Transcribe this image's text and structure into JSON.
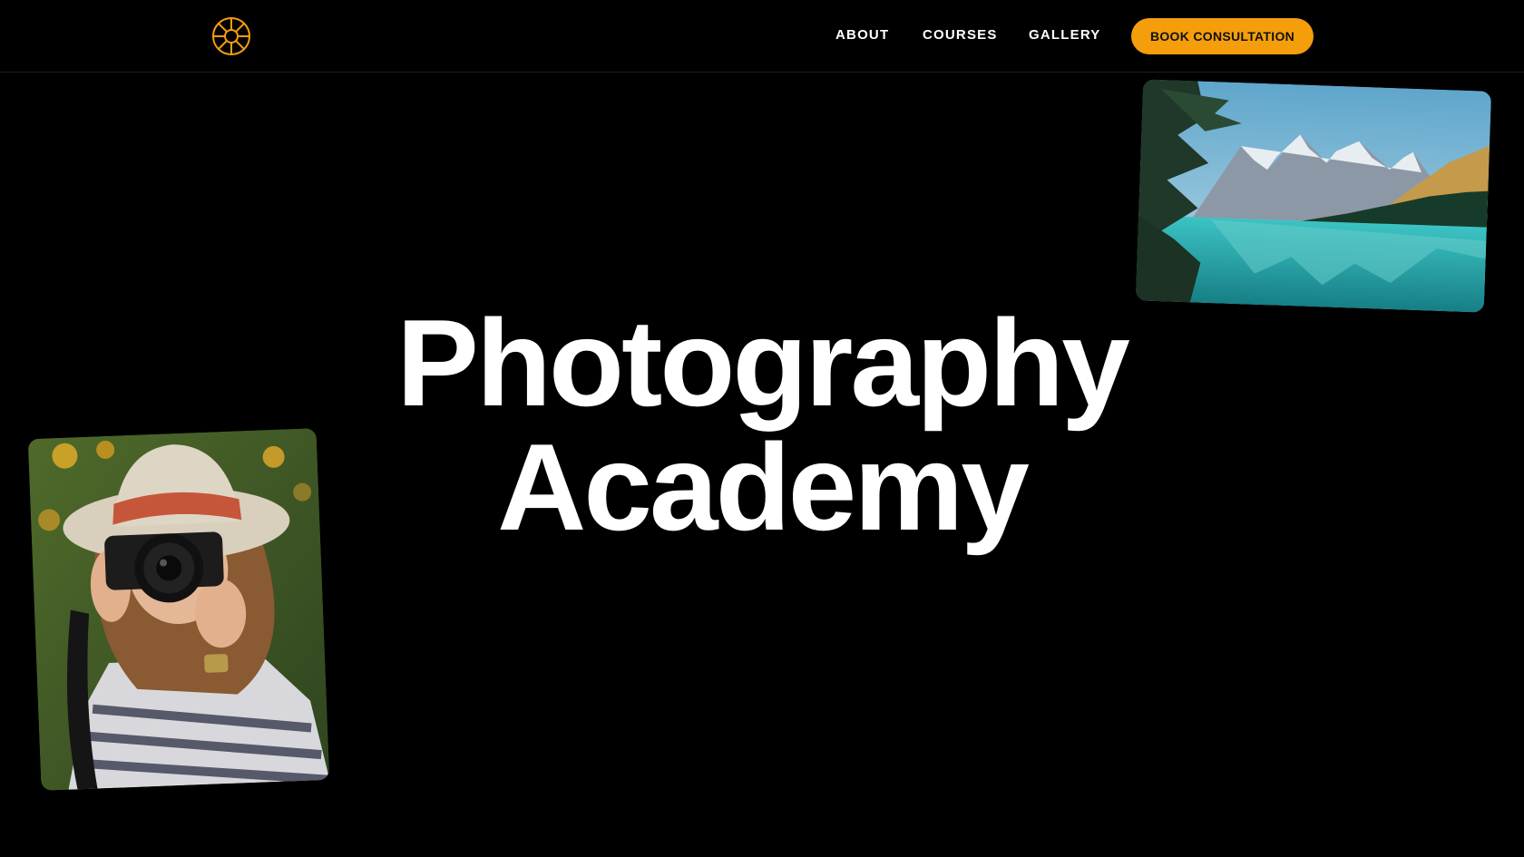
{
  "nav": {
    "logo_icon": "aperture-icon",
    "links": [
      {
        "label": "ABOUT"
      },
      {
        "label": "COURSES"
      },
      {
        "label": "GALLERY"
      }
    ],
    "cta_label": "BOOK CONSULTATION"
  },
  "hero": {
    "title_line1": "Photography",
    "title_line2": "Academy"
  },
  "colors": {
    "background": "#000000",
    "accent": "#f59e0b",
    "text": "#ffffff"
  }
}
